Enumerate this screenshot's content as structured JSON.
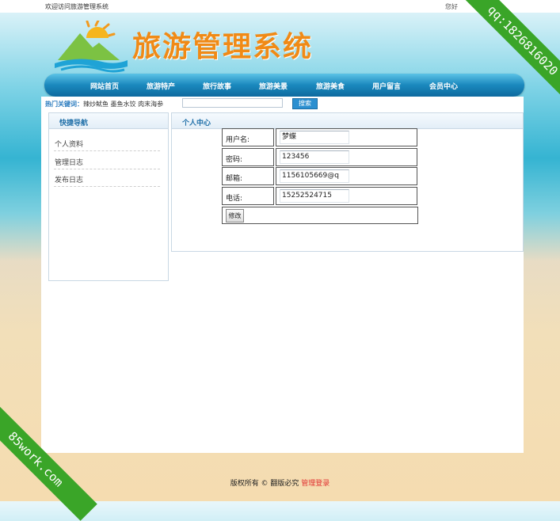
{
  "topbar": {
    "welcome": "欢迎访问旅游管理系统",
    "hello": "您好"
  },
  "header": {
    "logo_text": "旅游管理系统"
  },
  "nav": [
    {
      "label": "网站首页"
    },
    {
      "label": "旅游特产"
    },
    {
      "label": "旅行故事"
    },
    {
      "label": "旅游美景"
    },
    {
      "label": "旅游美食"
    },
    {
      "label": "用户留言"
    },
    {
      "label": "会员中心"
    }
  ],
  "search": {
    "hot_label": "热门关键词：",
    "hot_keywords": "辣炒鱿鱼 墨鱼水饺 肉末海参",
    "input_value": "",
    "button_label": "搜索"
  },
  "sidebar": {
    "title": "快捷导航",
    "items": [
      {
        "label": "个人资料"
      },
      {
        "label": "管理日志"
      },
      {
        "label": "发布日志"
      }
    ]
  },
  "content": {
    "title": "个人中心",
    "fields": [
      {
        "label": "用户名:",
        "value": "梦蝶"
      },
      {
        "label": "密码:",
        "value": "123456"
      },
      {
        "label": "邮箱:",
        "value": "1156105669@q"
      },
      {
        "label": "电话:",
        "value": "15252524715"
      }
    ],
    "submit_label": "修改"
  },
  "footer": {
    "copyright": "版权所有 © 翻版必究",
    "admin_link": "管理登录"
  },
  "watermarks": {
    "right": "qq:1826816020",
    "left": "85work.com"
  },
  "colors": {
    "accent": "#1f6fa8",
    "nav": "#1a88bd",
    "logo": "#f08a16",
    "ribbon": "#3aa528",
    "admin_link": "#e03030"
  }
}
